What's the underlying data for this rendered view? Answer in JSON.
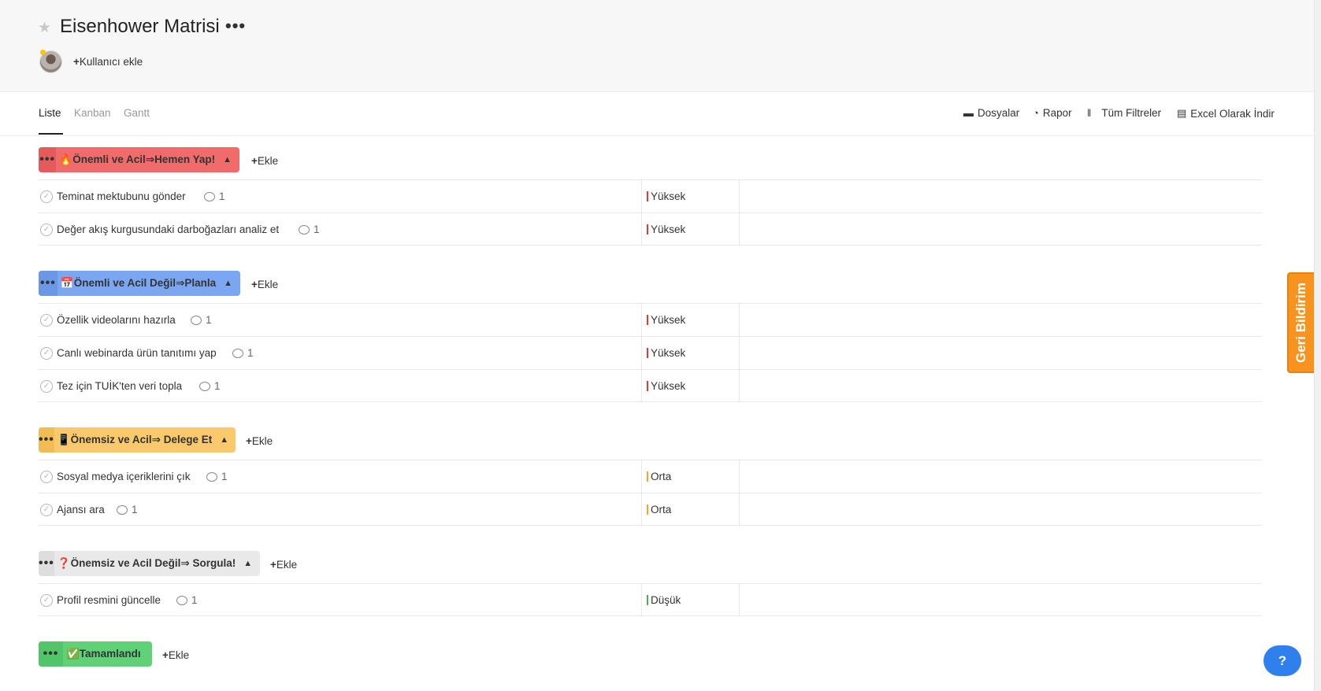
{
  "header": {
    "title": "Eisenhower Matrisi",
    "more": "•••",
    "add_user": "Kullanıcı ekle"
  },
  "tabs": [
    {
      "label": "Liste",
      "active": true
    },
    {
      "label": "Kanban",
      "active": false
    },
    {
      "label": "Gantt",
      "active": false
    }
  ],
  "tools": {
    "files": "Dosyalar",
    "report": "Rapor",
    "filters": "Tüm Filtreler",
    "excel": "Excel Olarak İndir"
  },
  "add_label": "Ekle",
  "groups": [
    {
      "label": "🔥Önemli ve Acil⇒Hemen Yap!",
      "color": "#f26b6b",
      "tasks": [
        {
          "title": "Teminat mektubunu gönder",
          "comments": "1",
          "priority": "Yüksek",
          "priority_color": "#e53935"
        },
        {
          "title": "Değer akış kurgusundaki darboğazları analiz et",
          "comments": "1",
          "priority": "Yüksek",
          "priority_color": "#e53935"
        }
      ]
    },
    {
      "label": "📅Önemli ve Acil Değil⇒Planla",
      "color": "#7ba7f2",
      "tasks": [
        {
          "title": "Özellik videolarını hazırla",
          "comments": "1",
          "priority": "Yüksek",
          "priority_color": "#e53935"
        },
        {
          "title": "Canlı webinarda ürün tanıtımı yap",
          "comments": "1",
          "priority": "Yüksek",
          "priority_color": "#e53935"
        },
        {
          "title": "Tez için TUİK'ten veri topla",
          "comments": "1",
          "priority": "Yüksek",
          "priority_color": "#e53935"
        }
      ]
    },
    {
      "label": "📱Önemsiz ve Acil⇒ Delege Et",
      "color": "#f9c96b",
      "tasks": [
        {
          "title": "Sosyal medya içeriklerini çık",
          "comments": "1",
          "priority": "Orta",
          "priority_color": "#f5a623"
        },
        {
          "title": "Ajansı ara",
          "comments": "1",
          "priority": "Orta",
          "priority_color": "#f5a623"
        }
      ]
    },
    {
      "label": "❓Önemsiz ve Acil Değil⇒ Sorgula!",
      "color": "#e9e9e9",
      "tasks": [
        {
          "title": "Profil resmini güncelle",
          "comments": "1",
          "priority": "Düşük",
          "priority_color": "#4caf50"
        }
      ]
    },
    {
      "label": "✅Tamamlandı",
      "color": "#5fd176",
      "tasks": []
    }
  ],
  "feedback": "Geri Bildirim",
  "help": "?"
}
